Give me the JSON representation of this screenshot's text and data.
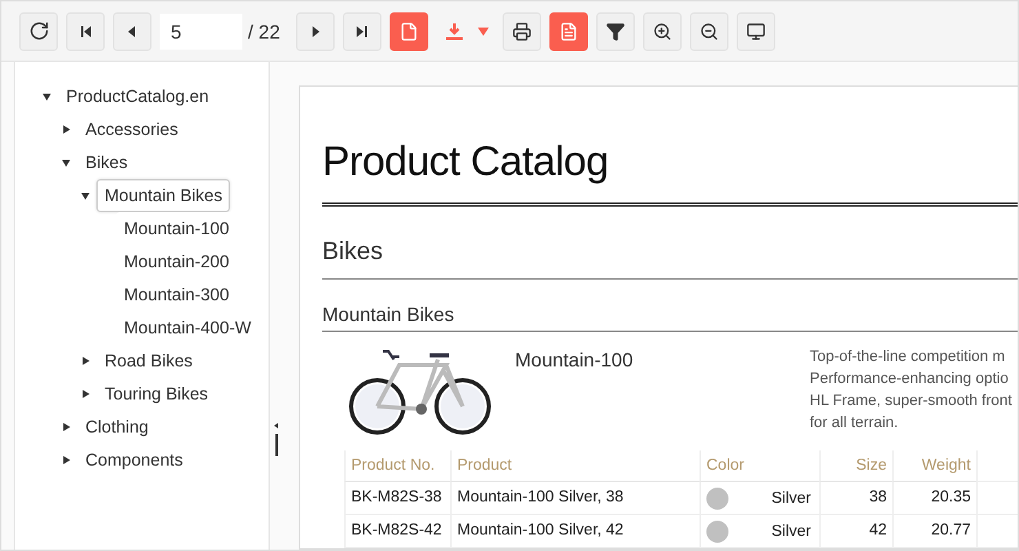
{
  "toolbar": {
    "items": [
      {
        "kind": "refresh",
        "active": false
      },
      {
        "kind": "first",
        "active": false
      },
      {
        "kind": "prev",
        "active": false
      },
      {
        "kind": "page_input",
        "value": "5"
      },
      {
        "kind": "page_count",
        "text": "/ 22"
      },
      {
        "kind": "next",
        "active": false
      },
      {
        "kind": "last",
        "active": false
      },
      {
        "kind": "document",
        "active": true
      },
      {
        "kind": "download",
        "active": false
      },
      {
        "kind": "print",
        "active": false
      },
      {
        "kind": "pages",
        "active": true
      },
      {
        "kind": "filter",
        "active": false
      },
      {
        "kind": "zoom_in",
        "active": false
      },
      {
        "kind": "zoom_out",
        "active": false
      },
      {
        "kind": "fullscreen",
        "active": false
      }
    ]
  },
  "tree": [
    {
      "label": "ProductCatalog.en",
      "kind": "folder",
      "expanded": true,
      "selected": false,
      "children": [
        {
          "label": "Accessories",
          "kind": "folder",
          "expanded": false,
          "selected": false
        },
        {
          "label": "Bikes",
          "kind": "folder",
          "expanded": true,
          "selected": false,
          "children": [
            {
              "label": "Mountain Bikes",
              "kind": "folder",
              "expanded": true,
              "selected": true,
              "children": [
                {
                  "label": "Mountain-100",
                  "kind": "item",
                  "selected": false
                },
                {
                  "label": "Mountain-200",
                  "kind": "item",
                  "selected": false
                },
                {
                  "label": "Mountain-300",
                  "kind": "item",
                  "selected": false
                },
                {
                  "label": "Mountain-400-W",
                  "kind": "item",
                  "selected": false
                }
              ]
            },
            {
              "label": "Road Bikes",
              "kind": "folder",
              "expanded": false,
              "selected": false
            },
            {
              "label": "Touring Bikes",
              "kind": "folder",
              "expanded": false,
              "selected": false
            }
          ]
        },
        {
          "label": "Clothing",
          "kind": "folder",
          "expanded": false,
          "selected": false
        },
        {
          "label": "Components",
          "kind": "folder",
          "expanded": false,
          "selected": false
        }
      ]
    }
  ],
  "document": {
    "title": "Product Catalog",
    "section": "Bikes",
    "subsection": "Mountain Bikes",
    "product": {
      "name": "Mountain-100",
      "description_lines": [
        "Top-of-the-line competition m",
        "Performance-enhancing optio",
        "HL Frame, super-smooth front",
        "for all terrain."
      ]
    },
    "table": {
      "columns": [
        "Product No.",
        "Product",
        "Color",
        "Size",
        "Weight"
      ],
      "rows": [
        {
          "product_no": "BK-M82S-38",
          "product": "Mountain-100 Silver, 38",
          "color": "#c0c0c0",
          "color_name": "Silver",
          "size": "38",
          "weight": "20.35"
        },
        {
          "product_no": "BK-M82S-42",
          "product": "Mountain-100 Silver, 42",
          "color": "#c0c0c0",
          "color_name": "Silver",
          "size": "42",
          "weight": "20.77"
        }
      ]
    }
  }
}
